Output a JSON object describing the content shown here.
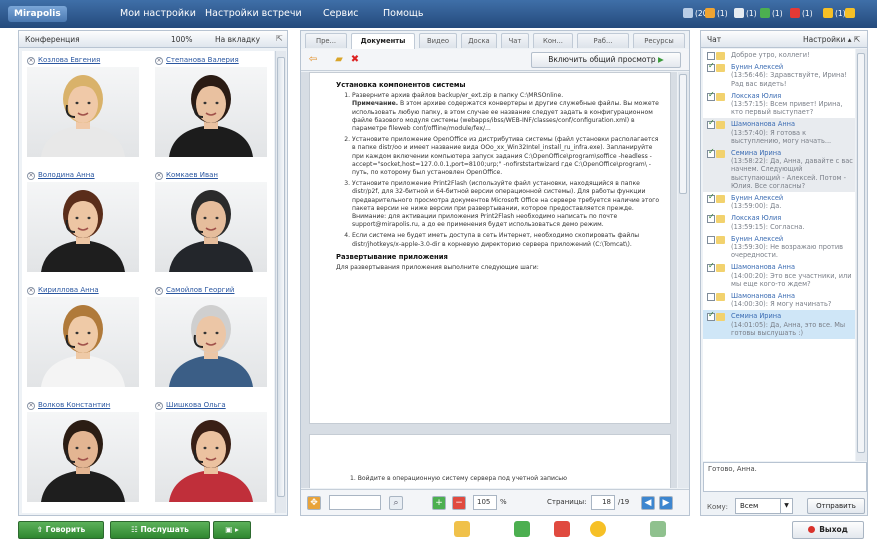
{
  "app": {
    "logo": "Mirapolis"
  },
  "menu": [
    "Мои настройки",
    "Настройки встречи",
    "Сервис",
    "Помощь"
  ],
  "stats": [
    {
      "icon": "users-icon",
      "value": "(20)",
      "color": "#b9cde6"
    },
    {
      "icon": "camera-icon",
      "value": "(1)",
      "color": "#f0a431"
    },
    {
      "icon": "screen-icon",
      "value": "(1)",
      "color": "#e6ecf2"
    },
    {
      "icon": "plus-icon",
      "value": "(1)",
      "color": "#4caf50"
    },
    {
      "icon": "minus-icon",
      "value": "(1)",
      "color": "#e53935"
    },
    {
      "icon": "smile-icon",
      "value": "(1)",
      "color": "#f6c026"
    },
    {
      "icon": "status-icon",
      "value": "",
      "color": "#f6c026"
    }
  ],
  "conference": {
    "title": "Конференция",
    "zoom": "100%",
    "fit": "На вкладку",
    "participants": [
      {
        "name": "Козлова Евгения",
        "skin": "#f0c9a8",
        "hair": "#d9b26a",
        "shirt": "#e8e8e8"
      },
      {
        "name": "Степанова Валерия",
        "skin": "#e9c1a0",
        "hair": "#2a1b14",
        "shirt": "#1c1c1c"
      },
      {
        "name": "Володина Анна",
        "skin": "#edc5a3",
        "hair": "#5a2d1a",
        "shirt": "#1e1e1e"
      },
      {
        "name": "Комкаев Иван",
        "skin": "#e6bd9c",
        "hair": "#2b2b2b",
        "shirt": "#23262b"
      },
      {
        "name": "Кириллова Анна",
        "skin": "#efcaa7",
        "hair": "#b07a3a",
        "shirt": "#f4f4f4"
      },
      {
        "name": "Самойлов Георгий",
        "skin": "#ecc6a6",
        "hair": "#cfcfcf",
        "shirt": "#3b5e86"
      },
      {
        "name": "Волков Константин",
        "skin": "#e3b592",
        "hair": "#2b1d14",
        "shirt": "#1e1e1e"
      },
      {
        "name": "Шишкова Ольга",
        "skin": "#ecc2a0",
        "hair": "#3a2016",
        "shirt": "#c02f3a"
      }
    ]
  },
  "buttons": {
    "speak": "Говорить",
    "listen": "Послушать",
    "exit": "Выход"
  },
  "document": {
    "tabs": [
      "Пре...",
      "Документы",
      "Видео",
      "Доска",
      "Чат",
      "Кон...",
      "Раб...",
      "Ресурсы"
    ],
    "share": "Включить общий просмотр",
    "heading": "Установка компонентов системы",
    "items": [
      {
        "text": "Разверните архив файлов backup/er_ext.zip в папку C:\\MRSOnline.",
        "note_bold": "Примечание.",
        "note": " В этом архиве содержатся конвертеры и другие служебные файлы. Вы можете использовать любую папку, в этом случае ее название следует задать в конфигурационном файле базового модуля системы (webapps/ibss/WEB-INF/classes/conf/configuration.xml) в параметре fileweb conf/offline/module/fex/..."
      },
      {
        "text": "Установите приложение OpenOffice из дистрибутива системы (файл установки располагается в папке distr/oo и имеет название вида OOo_xx_Win32Intel_install_ru_infra.exe). Запланируйте при каждом включении компьютера запуск задания C:\\OpenOffice\\program\\soffice -headless -accept=\"socket,host=127.0.0.1,port=8100;urp;\" -nofirststartwizard где C:\\OpenOffice\\program\\ - путь, по которому был установлен OpenOffice."
      },
      {
        "text": "Установите приложение Print2Flash (используйте файл установки, находящийся в папке distr/p2f, для 32-битной и 64-битной версии операционной системы). Для работы функции предварительного просмотра документов Microsoft Office на сервере требуется наличие этого пакета версии не ниже версии при развертывании, которое предоставляется прежде. Внимание: для активации приложения Print2Flash необходимо написать по почте support@mirapolis.ru, а до ее применения будет использоваться демо режим."
      },
      {
        "text": "Если система не будет иметь доступа в сеть Интернет, необходимо скопировать файлы distr/jhotkeys/x-apple-3.0-dir в корневую директорию сервера приложений (C:\\Tomcat\\)."
      }
    ],
    "section2": "Развертывание приложения",
    "section2_text": "Для развертывания приложения выполните следующие шаги:",
    "page2_text": "1.  Войдите в операционную систему сервера под учетной записью",
    "zoom": "105",
    "zoom_unit": "%",
    "pages_label": "Страницы:",
    "page": "18",
    "pages_total": "/19"
  },
  "chat": {
    "title": "Чат",
    "settings": "Настройки",
    "messages": [
      {
        "checked": false,
        "author": "",
        "time": "",
        "text": "Доброе утро, коллеги!",
        "style": ""
      },
      {
        "checked": true,
        "author": "Бунин Алексей",
        "time": "(13:56:46):",
        "text": "Здравствуйте, Ирина! Рад вас видеть!",
        "style": ""
      },
      {
        "checked": true,
        "author": "Локская Юлия",
        "time": "(13:57:15):",
        "text": "Всем привет! Ирина, кто первый выступает?",
        "style": ""
      },
      {
        "checked": true,
        "author": "Шамонанова Анна",
        "time": "(13:57:40):",
        "text": "Я готова к выступлению, могу начать...",
        "style": "gray"
      },
      {
        "checked": true,
        "author": "Семина Ирина",
        "time": "(13:58:22):",
        "text": "Да, Анна, давайте с вас начнем. Следующий выступающий - Алексей. Потом - Юлия. Все согласны?",
        "style": "gray"
      },
      {
        "checked": true,
        "author": "Бунин Алексей",
        "time": "(13:59:00):",
        "text": "Да.",
        "style": ""
      },
      {
        "checked": true,
        "author": "Локская Юлия",
        "time": "(13:59:15):",
        "text": "Согласна.",
        "style": ""
      },
      {
        "checked": false,
        "author": "Бунин Алексей",
        "time": "(13:59:30):",
        "text": "Не возражаю против очередности.",
        "style": ""
      },
      {
        "checked": true,
        "author": "Шамонанова Анна",
        "time": "(14:00:20):",
        "text": "Это все участники, или мы еще кого-то ждем?",
        "style": ""
      },
      {
        "checked": false,
        "author": "Шамонанова Анна",
        "time": "(14:00:30):",
        "text": "Я могу начинать?",
        "style": ""
      },
      {
        "checked": true,
        "author": "Семина Ирина",
        "time": "(14:01:05):",
        "text": "Да, Анна, это все. Мы готовы выслушать :)",
        "style": "sel"
      }
    ],
    "input_text": "Готово, Анна.",
    "to_label": "Кому:",
    "to_value": "Всем",
    "send": "Отправить"
  }
}
